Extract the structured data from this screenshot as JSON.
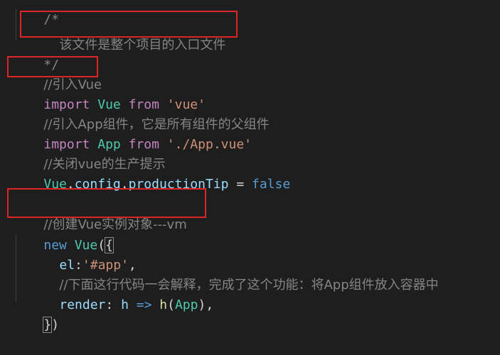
{
  "code": {
    "lines": {
      "l1": "/*",
      "l2": "该文件是整个项目的入口文件",
      "l3": "*/",
      "l4": "//引入Vue",
      "l5_kw": "import",
      "l5_cls": "Vue",
      "l5_from": "from",
      "l5_str": "'vue'",
      "l6": "//引入App组件，它是所有组件的父组件",
      "l7_kw": "import",
      "l7_cls": "App",
      "l7_from": "from",
      "l7_str": "'./App.vue'",
      "l8": "//关闭vue的生产提示",
      "l9_obj": "Vue",
      "l9_dot1": ".",
      "l9_prop1": "config",
      "l9_dot2": ".",
      "l9_prop2": "productionTip",
      "l9_eq": " = ",
      "l9_val": "false",
      "l11": "//创建Vue实例对象---vm",
      "l12_new": "new",
      "l12_cls": "Vue",
      "l12_paren": "(",
      "l12_brace": "{",
      "l13_key": "el",
      "l13_colon": ":",
      "l13_str": "'#app'",
      "l13_comma": ",",
      "l14": "//下面这行代码一会解释，完成了这个功能：将App组件放入容器中",
      "l15_key": "render",
      "l15_colon": ": ",
      "l15_param": "h",
      "l15_arrow": " => ",
      "l15_fn": "h",
      "l15_open": "(",
      "l15_arg": "App",
      "l15_close": "),",
      "l16_brace": "}",
      "l16_paren": ")"
    }
  },
  "colors": {
    "background": "#1e1e1e",
    "comment": "#6a9955",
    "keyword": "#c586c0",
    "class": "#4ec9b0",
    "string": "#ce9178",
    "property": "#9cdcfe",
    "highlight_box": "#e02424"
  }
}
